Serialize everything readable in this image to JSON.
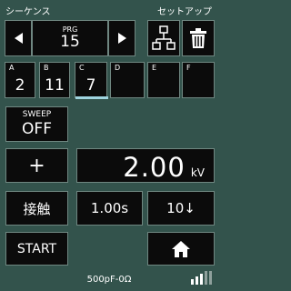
{
  "header": {
    "left_title": "シーケンス",
    "right_title": "セットアップ"
  },
  "program": {
    "label": "PRG",
    "value": "15"
  },
  "slots": [
    {
      "letter": "A",
      "value": "2"
    },
    {
      "letter": "B",
      "value": "11"
    },
    {
      "letter": "C",
      "value": "7",
      "selected": true
    },
    {
      "letter": "D",
      "value": ""
    },
    {
      "letter": "E",
      "value": ""
    },
    {
      "letter": "F",
      "value": ""
    }
  ],
  "sweep": {
    "label": "SWEEP",
    "value": "OFF"
  },
  "polarity": {
    "symbol": "+"
  },
  "voltage": {
    "value": "2.00",
    "unit": "kV"
  },
  "mode": {
    "label": "接触"
  },
  "interval": {
    "value": "1.00s"
  },
  "count": {
    "value": "10↓"
  },
  "start": {
    "label": "START"
  },
  "footer": {
    "status": "500pF-0Ω"
  },
  "colors": {
    "background": "#33534c",
    "button": "#0b0b0b",
    "border": "#6f8781",
    "accent": "#9fd4df"
  },
  "icons": [
    "left-arrow-icon",
    "right-arrow-icon",
    "tree-icon",
    "trash-icon",
    "home-icon",
    "signal-icon"
  ]
}
